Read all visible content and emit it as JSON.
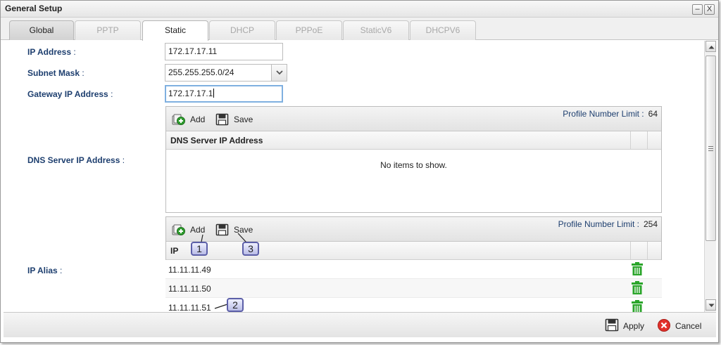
{
  "window": {
    "title": "General Setup",
    "minimize_label": "–",
    "close_label": "X"
  },
  "tabs": [
    {
      "label": "Global",
      "state": "enabled"
    },
    {
      "label": "PPTP",
      "state": "disabled"
    },
    {
      "label": "Static",
      "state": "active"
    },
    {
      "label": "DHCP",
      "state": "disabled"
    },
    {
      "label": "PPPoE",
      "state": "disabled"
    },
    {
      "label": "StaticV6",
      "state": "disabled"
    },
    {
      "label": "DHCPV6",
      "state": "disabled"
    }
  ],
  "form": {
    "ip_address": {
      "label": "IP Address",
      "colon": " :",
      "value": "172.17.17.11"
    },
    "subnet_mask": {
      "label": "Subnet Mask",
      "colon": " :",
      "value": "255.255.255.0/24"
    },
    "gateway": {
      "label": "Gateway IP Address",
      "colon": " :",
      "value": "172.17.17.1"
    },
    "dns": {
      "label": "DNS Server IP Address",
      "colon": " :"
    },
    "ip_alias": {
      "label": "IP Alias",
      "colon": " :"
    }
  },
  "dns_grid": {
    "add_label": "Add",
    "save_label": "Save",
    "limit_label": "Profile Number Limit :",
    "limit_value": "64",
    "column_header": "DNS Server IP Address",
    "empty_message": "No items to show."
  },
  "alias_grid": {
    "add_label": "Add",
    "save_label": "Save",
    "limit_label": "Profile Number Limit :",
    "limit_value": "254",
    "column_header": "IP",
    "rows": [
      "11.11.11.49",
      "11.11.11.50",
      "11.11.11.51"
    ]
  },
  "callouts": [
    "1",
    "2",
    "3"
  ],
  "footer": {
    "apply_label": "Apply",
    "cancel_label": "Cancel"
  },
  "icons": {
    "add": "add-icon",
    "save": "save-icon",
    "delete": "trash-icon",
    "apply": "save-icon",
    "cancel": "cancel-icon",
    "dropdown": "chevron-down-icon"
  },
  "colors": {
    "label_blue": "#1e3f6f",
    "trash_green": "#2aa52a",
    "cancel_red": "#e2312b",
    "callout_border": "#5c5fa8"
  }
}
